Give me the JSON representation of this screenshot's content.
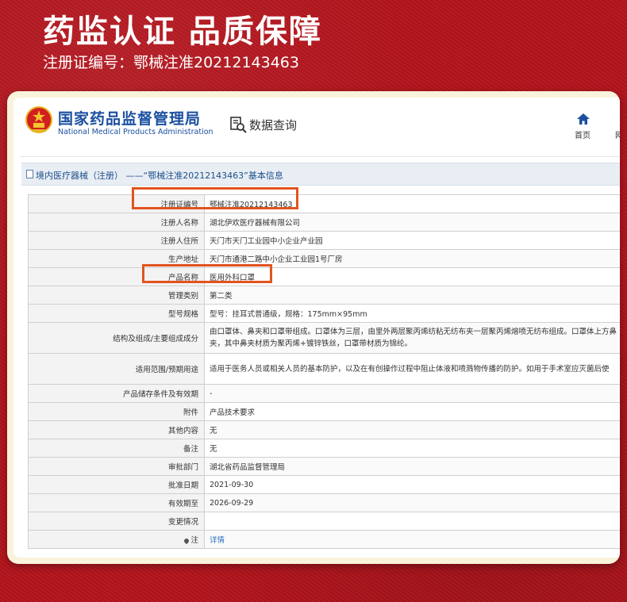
{
  "banner": {
    "title": "药监认证 品质保障",
    "subtitle": "注册证编号：鄂械注准20212143463"
  },
  "site": {
    "name_cn": "国家药品监督管理局",
    "name_en": "National Medical Products Administration",
    "query_label": "数据查询",
    "nav_home": "首页",
    "nav_next": "网"
  },
  "breadcrumb": {
    "text": "境内医疗器械（注册） ——“鄂械注准20212143463”基本信息"
  },
  "rows": [
    {
      "label": "注册证编号",
      "value": "鄂械注准20212143463"
    },
    {
      "label": "注册人名称",
      "value": "湖北伊欢医疗器械有限公司"
    },
    {
      "label": "注册人住所",
      "value": "天门市天门工业园中小企业产业园"
    },
    {
      "label": "生产地址",
      "value": "天门市通港二路中小企业工业园1号厂房"
    },
    {
      "label": "产品名称",
      "value": "医用外科口罩"
    },
    {
      "label": "管理类别",
      "value": "第二类"
    },
    {
      "label": "型号规格",
      "value": "型号：挂耳式普通级，规格：175mm×95mm"
    },
    {
      "label": "结构及组成/主要组成成分",
      "value": "由口罩体、鼻夹和口罩带组成。口罩体为三层，由里外两层聚丙烯纺粘无纺布夹一层聚丙烯熔喷无纺布组成。口罩体上方鼻夹，其中鼻夹材质为聚丙烯+镀锌铁丝，口罩带材质为锦纶。"
    },
    {
      "label": "适用范围/预期用途",
      "value": "适用于医务人员或相关人员的基本防护，以及在有创操作过程中阻止体液和喷溅物传播的防护。如用于手术室应灭菌后使"
    },
    {
      "label": "产品储存条件及有效期",
      "value": "-"
    },
    {
      "label": "附件",
      "value": "产品技术要求"
    },
    {
      "label": "其他内容",
      "value": "无"
    },
    {
      "label": "备注",
      "value": "无"
    },
    {
      "label": "审批部门",
      "value": "湖北省药品监督管理局"
    },
    {
      "label": "批准日期",
      "value": "2021-09-30"
    },
    {
      "label": "有效期至",
      "value": "2026-09-29"
    },
    {
      "label": "变更情况",
      "value": ""
    },
    {
      "label": "注",
      "value": "详情"
    }
  ],
  "colors": {
    "background_red": "#b3141c",
    "highlight_orange": "#e2541f",
    "site_blue": "#1b4fa0",
    "link_blue": "#2a6fc0"
  },
  "icons": [
    "national-emblem-icon",
    "data-query-icon",
    "home-icon",
    "document-icon",
    "pin-icon"
  ]
}
